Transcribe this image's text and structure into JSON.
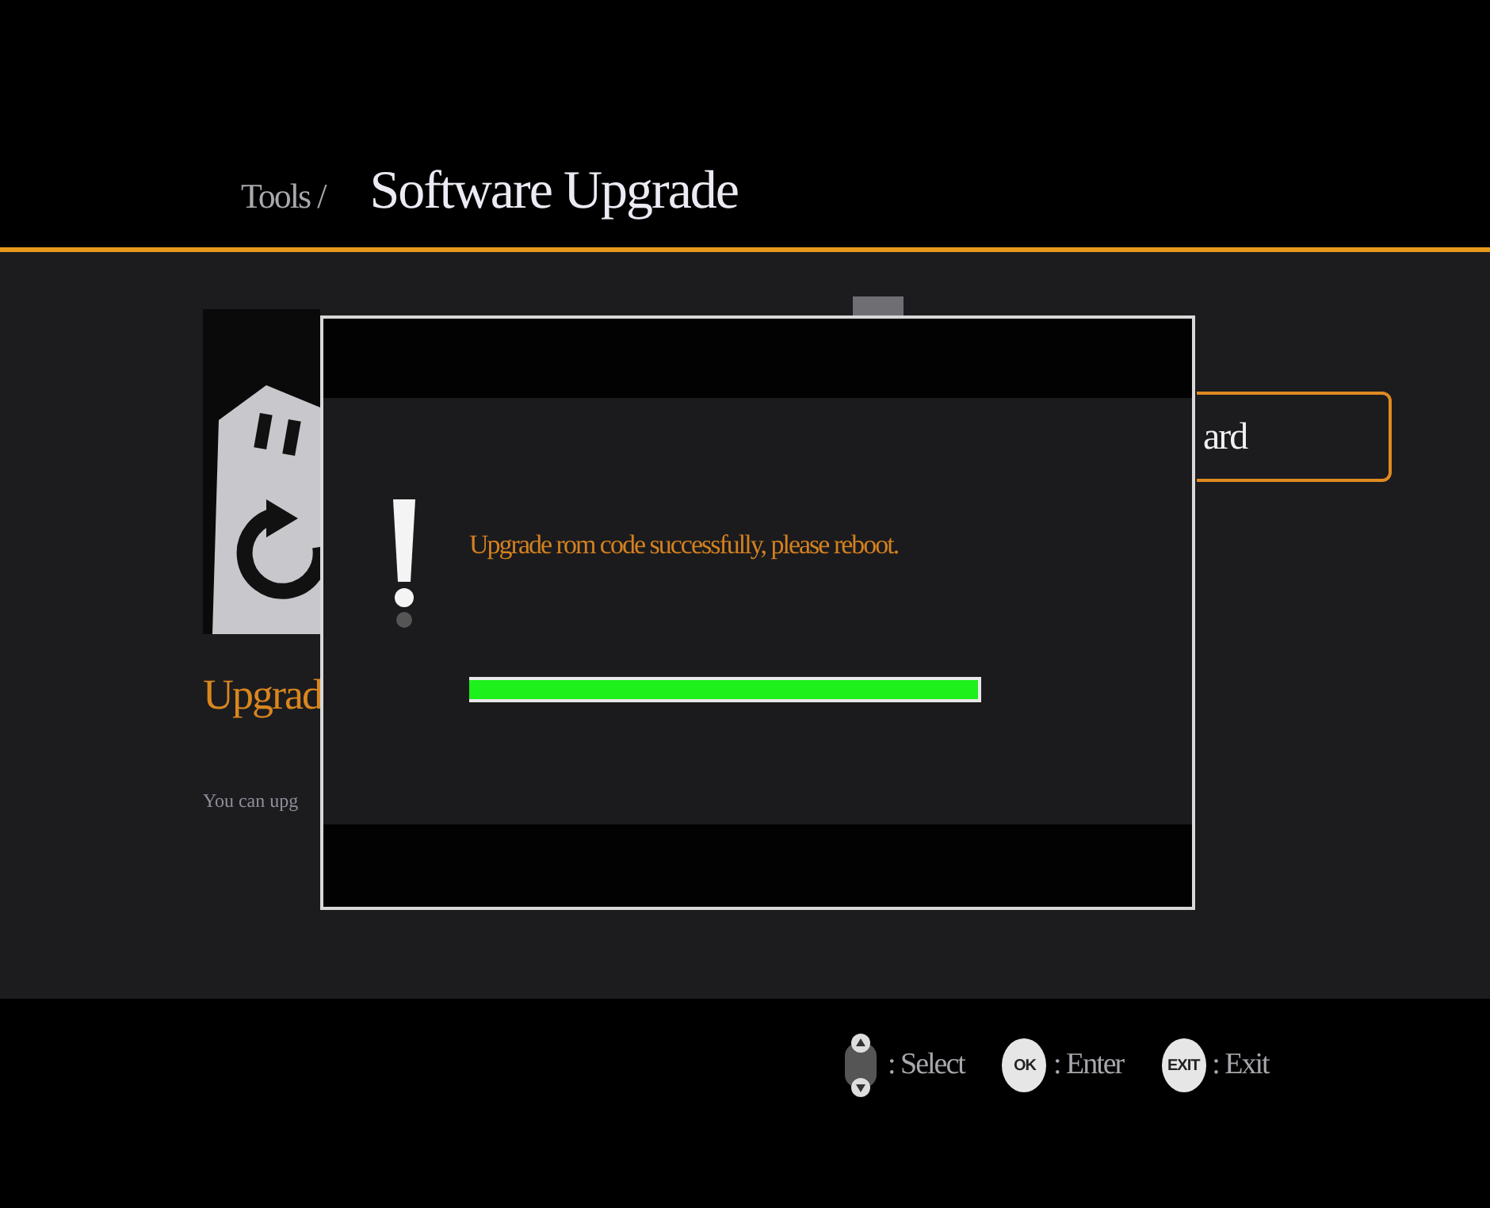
{
  "header": {
    "breadcrumb": "Tools /",
    "title": "Software Upgrade"
  },
  "panel": {
    "heading": "Upgrad",
    "description": "You can upg",
    "button": {
      "label": "ard",
      "selected": true
    }
  },
  "dialog": {
    "message": "Upgrade rom code successfully, please reboot.",
    "progress": {
      "level": 1
    }
  },
  "hints": [
    {
      "kind": "dpad",
      "label": ": Select"
    },
    {
      "kind": "key",
      "key": "OK",
      "label": ": Enter"
    },
    {
      "kind": "key",
      "key": "EXIT",
      "label": ": Exit"
    }
  ]
}
